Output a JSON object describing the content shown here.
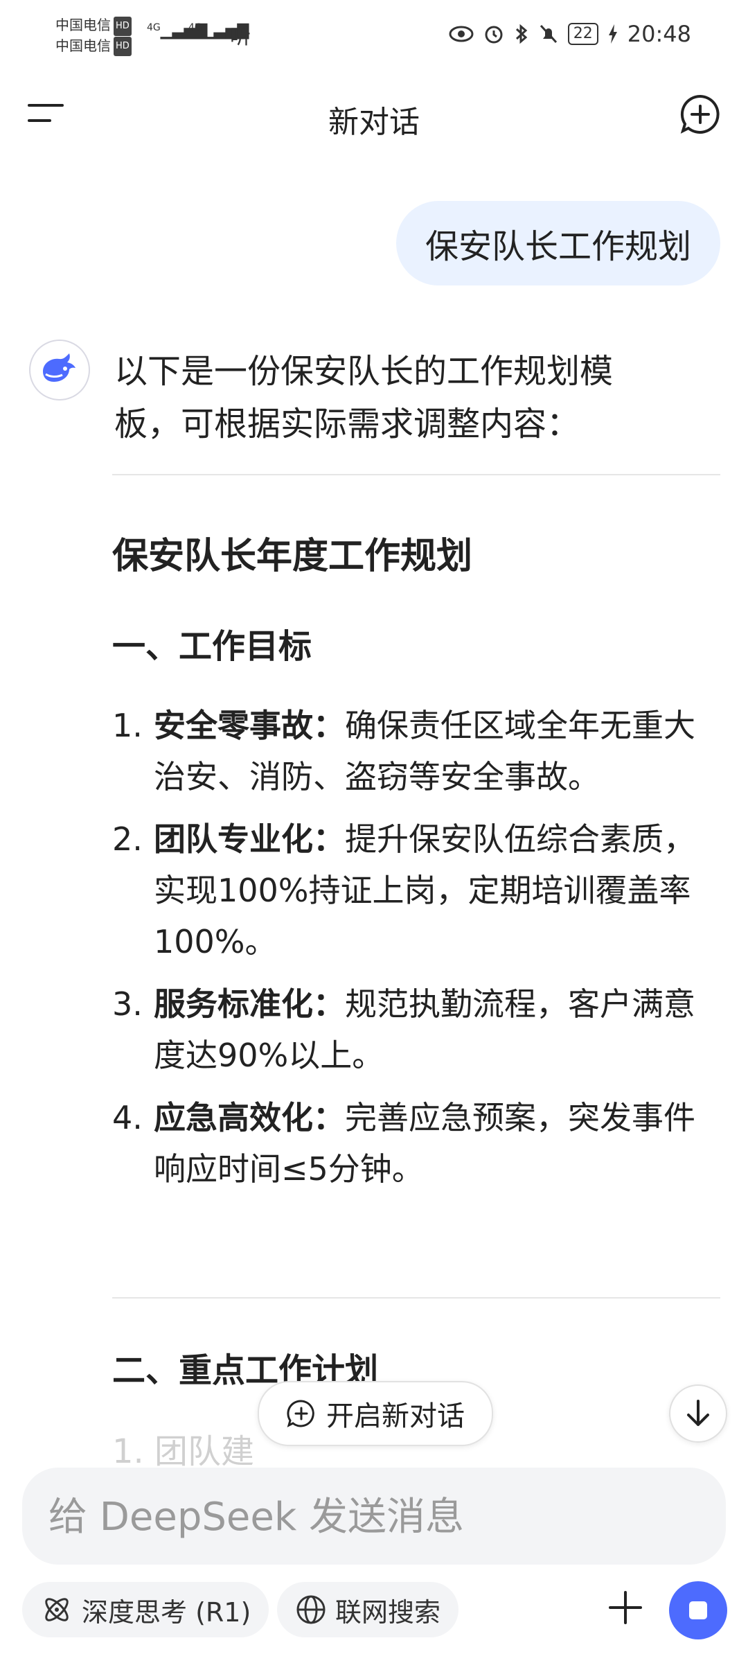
{
  "status_bar": {
    "carrier_1": "中国电信",
    "carrier_2": "中国电信",
    "hd_badge": "HD",
    "network": "4G",
    "listen_label": "听",
    "battery_level": "22",
    "time": "20:48"
  },
  "header": {
    "title": "新对话"
  },
  "user_message": "保安队长工作规划",
  "assistant": {
    "intro_line_1": "以下是一份保安队长的工作规划模",
    "intro_line_2": "板，可根据实际需求调整内容：",
    "heading": "保安队长年度工作规划",
    "section_1": "一、工作目标",
    "goals": [
      {
        "num": "1.",
        "title": "安全零事故：",
        "text": "确保责任区域全年无重大治安、消防、盗窃等安全事故。"
      },
      {
        "num": "2.",
        "title": "团队专业化：",
        "text": "提升保安队伍综合素质，实现100%持证上岗，定期培训覆盖率100%。"
      },
      {
        "num": "3.",
        "title": "服务标准化：",
        "text": "规范执勤流程，客户满意度达90%以上。"
      },
      {
        "num": "4.",
        "title": "应急高效化：",
        "text": "完善应急预案，突发事件响应时间≤5分钟。"
      }
    ],
    "section_2": "二、重点工作计划",
    "next_item_partial": "1. 团队建"
  },
  "floating": {
    "new_conversation": "开启新对话"
  },
  "input": {
    "placeholder": "给 DeepSeek 发送消息"
  },
  "toolbar": {
    "deep_think": "深度思考 (R1)",
    "web_search": "联网搜索"
  },
  "colors": {
    "accent": "#4d6bfe",
    "user_bubble": "#eaf2ff",
    "input_bg": "#f3f4f6"
  }
}
